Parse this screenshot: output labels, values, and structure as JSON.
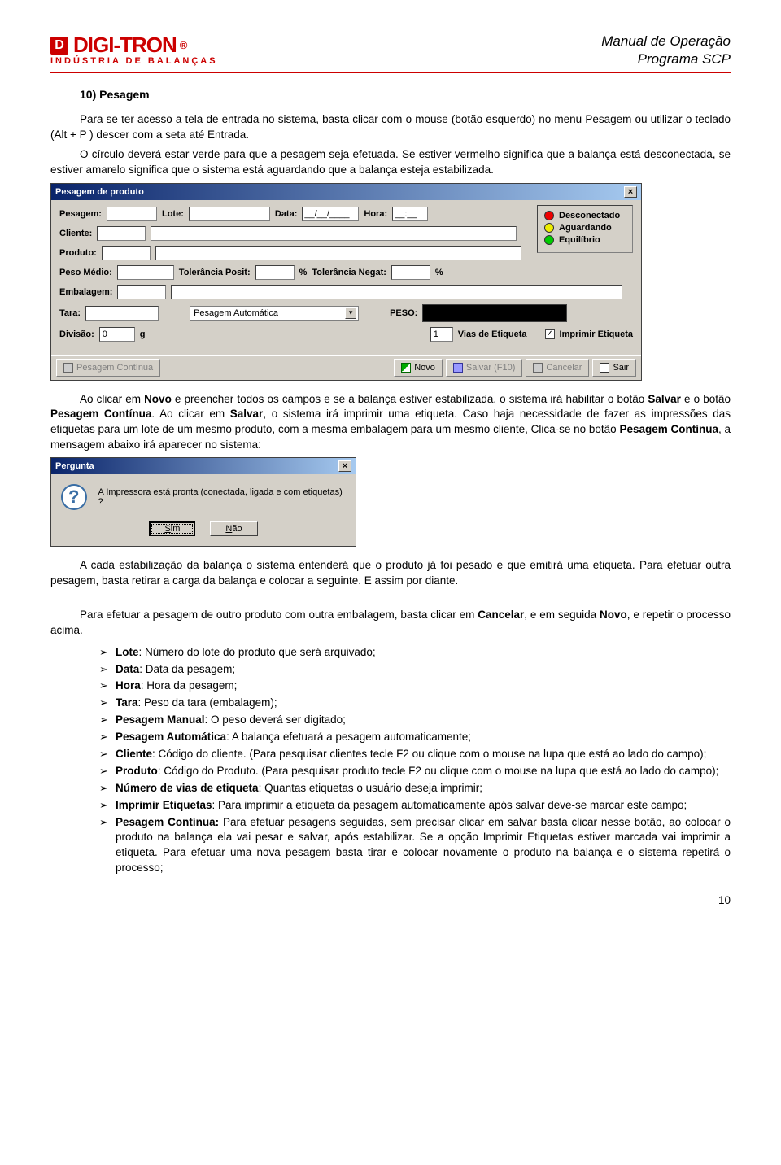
{
  "header": {
    "logo_main": "DIGI-TRON",
    "logo_reg": "®",
    "logo_sub": "INDÚSTRIA DE BALANÇAS",
    "title_line1": "Manual de Operação",
    "title_line2": "Programa SCP"
  },
  "section": {
    "title": "10) Pesagem",
    "p1": "Para se ter acesso a tela de entrada no sistema, basta clicar com o mouse (botão esquerdo) no menu Pesagem ou utilizar o teclado (Alt + P ) descer com a seta até Entrada.",
    "p2": "O círculo deverá estar verde para que a pesagem seja efetuada. Se estiver vermelho significa que a balança está desconectada, se estiver amarelo significa que o sistema está aguardando que a balança esteja estabilizada."
  },
  "win1": {
    "title": "Pesagem de produto",
    "labels": {
      "pesagem": "Pesagem:",
      "lote": "Lote:",
      "data": "Data:",
      "data_mask": "__/__/____",
      "hora": "Hora:",
      "hora_mask": "__:__",
      "cliente": "Cliente:",
      "produto": "Produto:",
      "peso_medio": "Peso Médio:",
      "tol_pos": "Tolerância Posit:",
      "tol_neg": "Tolerância Negat:",
      "pct": "%",
      "embalagem": "Embalagem:",
      "tara": "Tara:",
      "pesagem_auto": "Pesagem Automática",
      "peso": "PESO:",
      "divisao": "Divisão:",
      "div_val": "0",
      "g": "g",
      "vias": "Vias de Etiqueta",
      "vias_val": "1",
      "imprimir": "Imprimir Etiqueta"
    },
    "status": {
      "desc": "Desconectado",
      "aguard": "Aguardando",
      "equil": "Equilíbrio"
    },
    "toolbar": {
      "cont": "Pesagem Contínua",
      "novo": "Novo",
      "salvar": "Salvar (F10)",
      "cancelar": "Cancelar",
      "sair": "Sair"
    }
  },
  "para3_parts": {
    "a": "Ao clicar em ",
    "novo": "Novo",
    "b": " e preencher todos os campos e se a balança estiver estabilizada, o sistema irá habilitar o botão ",
    "salvar": "Salvar",
    "c": " e o botão ",
    "pcont": "Pesagem Contínua",
    "d": ". Ao clicar em ",
    "salvar2": "Salvar",
    "e": ", o sistema irá imprimir uma etiqueta. Caso haja necessidade de fazer as impressões das etiquetas para um lote de um mesmo produto, com a mesma embalagem para um mesmo cliente, Clica-se no botão ",
    "pcont2": "Pesagem Contínua",
    "f": ", a mensagem abaixo irá aparecer no sistema:"
  },
  "dlg": {
    "title": "Pergunta",
    "msg": "A Impressora está pronta (conectada, ligada e com etiquetas) ?",
    "sim": "Sim",
    "nao": "Não"
  },
  "para4": "A cada estabilização da balança o sistema entenderá que o produto já foi pesado e que emitirá uma etiqueta. Para efetuar outra pesagem, basta retirar a carga da balança e colocar a seguinte. E assim por diante.",
  "para5_parts": {
    "a": "Para efetuar a pesagem de outro produto com outra embalagem, basta clicar em ",
    "cancelar": "Cancelar",
    "b": ", e em seguida ",
    "novo": "Novo",
    "c": ", e repetir o processo acima."
  },
  "list": [
    {
      "k": "Lote",
      "v": ": Número do lote do produto que será arquivado;"
    },
    {
      "k": "Data",
      "v": ": Data da pesagem;"
    },
    {
      "k": "Hora",
      "v": ": Hora da pesagem;"
    },
    {
      "k": "Tara",
      "v": ": Peso da tara (embalagem);"
    },
    {
      "k": "Pesagem Manual",
      "v": ": O peso deverá ser digitado;"
    },
    {
      "k": "Pesagem Automática",
      "v": ": A balança efetuará a pesagem automaticamente;"
    },
    {
      "k": "Cliente",
      "v": ": Código do cliente. (Para pesquisar clientes tecle F2 ou clique com o mouse na lupa que está ao lado do campo);"
    },
    {
      "k": "Produto",
      "v": ": Código do Produto. (Para pesquisar produto tecle F2 ou clique com o mouse na lupa que está ao lado do campo);"
    },
    {
      "k": "Número de vias de etiqueta",
      "v": ": Quantas etiquetas o usuário deseja imprimir;"
    },
    {
      "k": "Imprimir Etiquetas",
      "v": ": Para imprimir a etiqueta da pesagem automaticamente após salvar deve-se marcar este campo;"
    },
    {
      "k": "Pesagem Contínua:",
      "v": " Para efetuar pesagens seguidas, sem precisar clicar em salvar basta clicar nesse botão, ao colocar o produto na balança ela vai pesar e salvar, após estabilizar. Se a opção Imprimir Etiquetas estiver marcada vai imprimir a etiqueta. Para efetuar uma nova pesagem basta tirar e colocar novamente o produto na balança e o sistema repetirá o processo;"
    }
  ],
  "pagenum": "10"
}
